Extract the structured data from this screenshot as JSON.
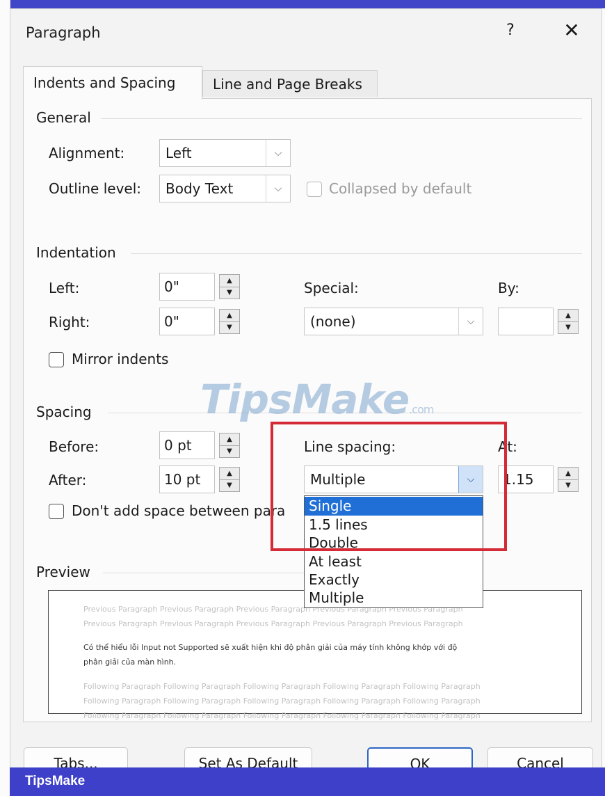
{
  "dialog": {
    "title": "Paragraph",
    "help": "?",
    "close": "✕"
  },
  "tabs": {
    "indents": "Indents and Spacing",
    "breaks": "Line and Page Breaks"
  },
  "general": {
    "heading": "General",
    "alignment_label": "Alignment:",
    "alignment_value": "Left",
    "outline_label": "Outline level:",
    "outline_value": "Body Text",
    "collapsed_label": "Collapsed by default"
  },
  "indentation": {
    "heading": "Indentation",
    "left_label": "Left:",
    "left_value": "0\"",
    "right_label": "Right:",
    "right_value": "0\"",
    "special_label": "Special:",
    "special_value": "(none)",
    "by_label": "By:",
    "by_value": "",
    "mirror_label": "Mirror indents"
  },
  "spacing": {
    "heading": "Spacing",
    "before_label": "Before:",
    "before_value": "0 pt",
    "after_label": "After:",
    "after_value": "10 pt",
    "line_spacing_label": "Line spacing:",
    "line_spacing_value": "Multiple",
    "at_label": "At:",
    "at_value": "1.15",
    "dont_add_label": "Don't add space between para",
    "options": [
      "Single",
      "1.5 lines",
      "Double",
      "At least",
      "Exactly",
      "Multiple"
    ],
    "highlighted_option": "Single"
  },
  "preview": {
    "heading": "Preview",
    "previous_1": "Previous Paragraph Previous Paragraph Previous Paragraph Previous Paragraph Previous Paragraph",
    "previous_2": "Previous Paragraph Previous Paragraph Previous Paragraph Previous Paragraph Previous Paragraph",
    "sample_1": "Có thể hiểu lỗi Input not Supported sẽ xuất hiện khi độ phân giải của máy tính không khớp với độ",
    "sample_2": "phân giải của màn hình.",
    "following_1": "Following Paragraph Following Paragraph Following Paragraph Following Paragraph Following Paragraph",
    "following_2": "Following Paragraph Following Paragraph Following Paragraph Following Paragraph Following Paragraph",
    "following_3": "Following Paragraph Following Paragraph Following Paragraph Following Paragraph Following Paragraph"
  },
  "buttons": {
    "tabs": "Tabs...",
    "set_default": "Set As Default",
    "ok": "OK",
    "cancel": "Cancel"
  },
  "watermark": {
    "text": "TipsMake",
    "suffix": ".com"
  },
  "footer": {
    "brand": "TipsMake"
  },
  "colors": {
    "accent": "#1f6fd6",
    "highlight_box": "#d42b36",
    "footer_bar": "#3e40c9"
  }
}
